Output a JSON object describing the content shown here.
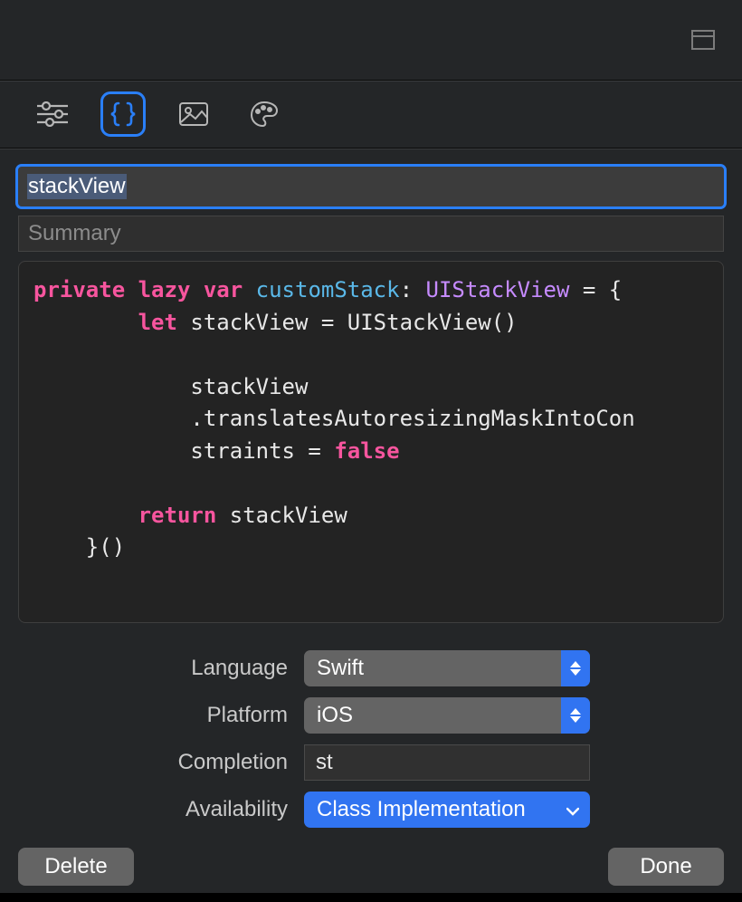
{
  "title_value": "stackView",
  "summary_placeholder": "Summary",
  "code": {
    "tokens": [
      {
        "t": "private ",
        "c": "k-pink"
      },
      {
        "t": "lazy ",
        "c": "k-pink"
      },
      {
        "t": "var ",
        "c": "k-pink"
      },
      {
        "t": "customStack",
        "c": "k-blue"
      },
      {
        "t": ": ",
        "c": "k-white"
      },
      {
        "t": "UIStackView",
        "c": "k-purple"
      },
      {
        "t": " = {\n        ",
        "c": "k-white"
      },
      {
        "t": "let ",
        "c": "k-pink"
      },
      {
        "t": "stackView = UIStackView()\n\n            stackView\n            .translatesAutoresizingMaskIntoCon\n            straints = ",
        "c": "k-white"
      },
      {
        "t": "false",
        "c": "k-pink"
      },
      {
        "t": "\n\n        ",
        "c": "k-white"
      },
      {
        "t": "return ",
        "c": "k-pink"
      },
      {
        "t": "stackView\n    }()",
        "c": "k-white"
      }
    ]
  },
  "form": {
    "language_label": "Language",
    "language_value": "Swift",
    "platform_label": "Platform",
    "platform_value": "iOS",
    "completion_label": "Completion",
    "completion_value": "st",
    "availability_label": "Availability",
    "availability_value": "Class Implementation"
  },
  "footer": {
    "delete_label": "Delete",
    "done_label": "Done"
  }
}
